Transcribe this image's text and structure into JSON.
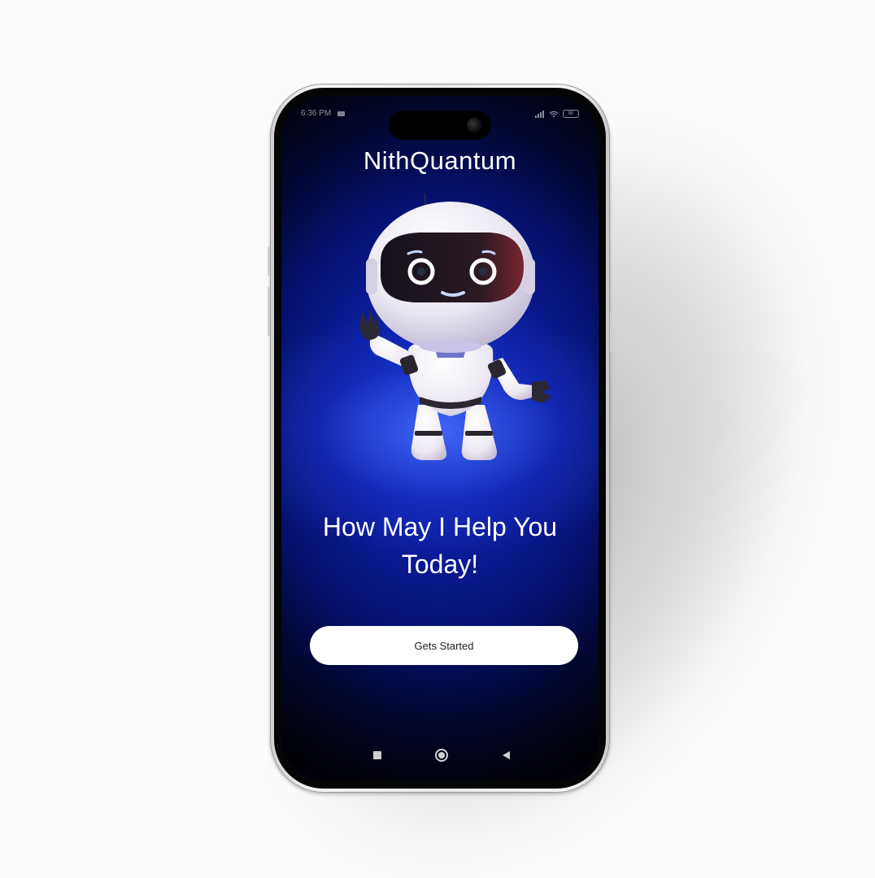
{
  "status_bar": {
    "time": "6:36 PM",
    "battery": "90",
    "icons": [
      "camera-icon",
      "signal-icon",
      "wifi-icon",
      "battery-icon"
    ]
  },
  "app": {
    "title": "NithQuantum"
  },
  "hero": {
    "illustration": "robot-mascot-waving",
    "headline_line1": "How May I Help You",
    "headline_line2": "Today!"
  },
  "cta": {
    "label": "Gets Started"
  },
  "nav": {
    "icons": [
      "recent-apps-icon",
      "home-icon",
      "back-icon"
    ]
  },
  "colors": {
    "background_primary": "#0a1c9a",
    "background_dark": "#000108",
    "glow": "#3c64ff",
    "button_bg": "#ffffff",
    "text": "#ffffff"
  }
}
